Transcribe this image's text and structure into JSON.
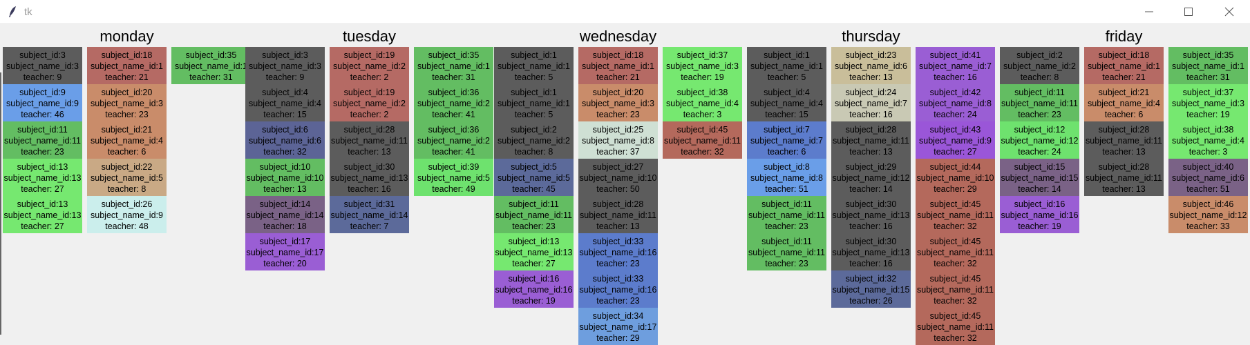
{
  "window": {
    "title": "tk",
    "app_icon": "tk-feather-icon",
    "controls": [
      "minimize-icon",
      "maximize-icon",
      "close-icon"
    ]
  },
  "labels": {
    "subject_id": "subject_id:",
    "subject_name_id": "subject_name_id:",
    "teacher": "teacher: "
  },
  "colors": {
    "dark": "#5c5c5c",
    "red": "#b56a64",
    "green": "#63bd62",
    "blue": "#6a9ee8",
    "orange": "#c98c6a",
    "lime": "#76e870",
    "tan": "#c9a985",
    "mint": "#cbeeec",
    "slate": "#5c6496",
    "plum": "#7a6286",
    "purple": "#9a5ed4",
    "slateblue": "#5c6a9a",
    "lightgreen": "#6ee26e",
    "sage": "#cfe0d4",
    "bluemid": "#5c7ccc",
    "khaki": "#c9be9a",
    "sand": "#c9c9b4",
    "violet": "#9a56d8",
    "redbrown": "#b4695c",
    "bluelight": "#6e9ede"
  },
  "days": [
    {
      "name": "monday",
      "columns": [
        [
          {
            "sid": "3",
            "sname": "3",
            "teacher": "9",
            "color": "dark"
          },
          {
            "sid": "9",
            "sname": "9",
            "teacher": "46",
            "color": "blue"
          },
          {
            "sid": "11",
            "sname": "11",
            "teacher": "23",
            "color": "green"
          },
          {
            "sid": "13",
            "sname": "13",
            "teacher": "27",
            "color": "lime"
          },
          {
            "sid": "13",
            "sname": "13",
            "teacher": "27",
            "color": "lime"
          }
        ],
        [
          {
            "sid": "18",
            "sname": "1",
            "teacher": "21",
            "color": "red"
          },
          {
            "sid": "20",
            "sname": "3",
            "teacher": "23",
            "color": "orange"
          },
          {
            "sid": "21",
            "sname": "4",
            "teacher": "6",
            "color": "orange"
          },
          {
            "sid": "22",
            "sname": "5",
            "teacher": "8",
            "color": "tan"
          },
          {
            "sid": "26",
            "sname": "9",
            "teacher": "48",
            "color": "mint"
          }
        ],
        [
          {
            "sid": "35",
            "sname": "1",
            "teacher": "31",
            "color": "green"
          }
        ]
      ]
    },
    {
      "name": "tuesday",
      "columns": [
        [
          {
            "sid": "3",
            "sname": "3",
            "teacher": "9",
            "color": "dark"
          },
          {
            "sid": "4",
            "sname": "4",
            "teacher": "15",
            "color": "dark"
          },
          {
            "sid": "6",
            "sname": "6",
            "teacher": "32",
            "color": "slate"
          },
          {
            "sid": "10",
            "sname": "10",
            "teacher": "13",
            "color": "green"
          },
          {
            "sid": "14",
            "sname": "14",
            "teacher": "18",
            "color": "plum"
          },
          {
            "sid": "17",
            "sname": "17",
            "teacher": "20",
            "color": "purple"
          }
        ],
        [
          {
            "sid": "19",
            "sname": "2",
            "teacher": "2",
            "color": "red"
          },
          {
            "sid": "19",
            "sname": "2",
            "teacher": "2",
            "color": "red"
          },
          {
            "sid": "28",
            "sname": "11",
            "teacher": "13",
            "color": "dark"
          },
          {
            "sid": "30",
            "sname": "13",
            "teacher": "16",
            "color": "dark"
          },
          {
            "sid": "31",
            "sname": "14",
            "teacher": "7",
            "color": "slateblue"
          }
        ],
        [
          {
            "sid": "35",
            "sname": "1",
            "teacher": "31",
            "color": "green"
          },
          {
            "sid": "36",
            "sname": "2",
            "teacher": "41",
            "color": "green"
          },
          {
            "sid": "36",
            "sname": "2",
            "teacher": "41",
            "color": "green"
          },
          {
            "sid": "39",
            "sname": "5",
            "teacher": "49",
            "color": "lightgreen"
          }
        ]
      ]
    },
    {
      "name": "wednesday",
      "columns": [
        [
          {
            "sid": "1",
            "sname": "1",
            "teacher": "5",
            "color": "dark"
          },
          {
            "sid": "1",
            "sname": "1",
            "teacher": "5",
            "color": "dark"
          },
          {
            "sid": "2",
            "sname": "2",
            "teacher": "8",
            "color": "dark"
          },
          {
            "sid": "5",
            "sname": "5",
            "teacher": "45",
            "color": "slateblue"
          },
          {
            "sid": "11",
            "sname": "11",
            "teacher": "23",
            "color": "green"
          },
          {
            "sid": "13",
            "sname": "13",
            "teacher": "27",
            "color": "lime"
          },
          {
            "sid": "16",
            "sname": "16",
            "teacher": "19",
            "color": "purple"
          }
        ],
        [
          {
            "sid": "18",
            "sname": "1",
            "teacher": "21",
            "color": "red"
          },
          {
            "sid": "20",
            "sname": "3",
            "teacher": "23",
            "color": "orange"
          },
          {
            "sid": "25",
            "sname": "8",
            "teacher": "37",
            "color": "sage"
          },
          {
            "sid": "27",
            "sname": "10",
            "teacher": "50",
            "color": "dark"
          },
          {
            "sid": "28",
            "sname": "11",
            "teacher": "13",
            "color": "dark"
          },
          {
            "sid": "33",
            "sname": "16",
            "teacher": "23",
            "color": "bluemid"
          },
          {
            "sid": "33",
            "sname": "16",
            "teacher": "23",
            "color": "bluemid"
          },
          {
            "sid": "34",
            "sname": "17",
            "teacher": "29",
            "color": "bluelight"
          }
        ],
        [
          {
            "sid": "37",
            "sname": "3",
            "teacher": "19",
            "color": "lime"
          },
          {
            "sid": "38",
            "sname": "4",
            "teacher": "3",
            "color": "lime"
          },
          {
            "sid": "45",
            "sname": "11",
            "teacher": "32",
            "color": "redbrown"
          }
        ]
      ]
    },
    {
      "name": "thursday",
      "columns": [
        [
          {
            "sid": "1",
            "sname": "1",
            "teacher": "5",
            "color": "dark"
          },
          {
            "sid": "4",
            "sname": "4",
            "teacher": "15",
            "color": "dark"
          },
          {
            "sid": "7",
            "sname": "7",
            "teacher": "6",
            "color": "bluemid"
          },
          {
            "sid": "8",
            "sname": "8",
            "teacher": "51",
            "color": "blue"
          },
          {
            "sid": "11",
            "sname": "11",
            "teacher": "23",
            "color": "green"
          },
          {
            "sid": "11",
            "sname": "11",
            "teacher": "23",
            "color": "green"
          }
        ],
        [
          {
            "sid": "23",
            "sname": "6",
            "teacher": "13",
            "color": "khaki"
          },
          {
            "sid": "24",
            "sname": "7",
            "teacher": "16",
            "color": "sand"
          },
          {
            "sid": "28",
            "sname": "11",
            "teacher": "13",
            "color": "dark"
          },
          {
            "sid": "29",
            "sname": "12",
            "teacher": "14",
            "color": "dark"
          },
          {
            "sid": "30",
            "sname": "13",
            "teacher": "16",
            "color": "dark"
          },
          {
            "sid": "30",
            "sname": "13",
            "teacher": "16",
            "color": "dark"
          },
          {
            "sid": "32",
            "sname": "15",
            "teacher": "26",
            "color": "slateblue"
          }
        ],
        [
          {
            "sid": "41",
            "sname": "7",
            "teacher": "16",
            "color": "purple"
          },
          {
            "sid": "42",
            "sname": "8",
            "teacher": "24",
            "color": "purple"
          },
          {
            "sid": "43",
            "sname": "9",
            "teacher": "27",
            "color": "violet"
          },
          {
            "sid": "44",
            "sname": "10",
            "teacher": "29",
            "color": "redbrown"
          },
          {
            "sid": "45",
            "sname": "11",
            "teacher": "32",
            "color": "redbrown"
          },
          {
            "sid": "45",
            "sname": "11",
            "teacher": "32",
            "color": "redbrown"
          },
          {
            "sid": "45",
            "sname": "11",
            "teacher": "32",
            "color": "redbrown"
          },
          {
            "sid": "45",
            "sname": "11",
            "teacher": "32",
            "color": "redbrown"
          }
        ]
      ]
    },
    {
      "name": "friday",
      "columns": [
        [
          {
            "sid": "2",
            "sname": "2",
            "teacher": "8",
            "color": "dark"
          },
          {
            "sid": "11",
            "sname": "11",
            "teacher": "23",
            "color": "green"
          },
          {
            "sid": "12",
            "sname": "12",
            "teacher": "24",
            "color": "lightgreen"
          },
          {
            "sid": "15",
            "sname": "15",
            "teacher": "14",
            "color": "plum"
          },
          {
            "sid": "16",
            "sname": "16",
            "teacher": "19",
            "color": "purple"
          }
        ],
        [
          {
            "sid": "18",
            "sname": "1",
            "teacher": "21",
            "color": "red"
          },
          {
            "sid": "21",
            "sname": "4",
            "teacher": "6",
            "color": "orange"
          },
          {
            "sid": "28",
            "sname": "11",
            "teacher": "13",
            "color": "dark"
          },
          {
            "sid": "28",
            "sname": "11",
            "teacher": "13",
            "color": "dark"
          }
        ],
        [
          {
            "sid": "35",
            "sname": "1",
            "teacher": "31",
            "color": "green"
          },
          {
            "sid": "37",
            "sname": "3",
            "teacher": "19",
            "color": "lime"
          },
          {
            "sid": "38",
            "sname": "4",
            "teacher": "3",
            "color": "lime"
          },
          {
            "sid": "40",
            "sname": "6",
            "teacher": "51",
            "color": "plum"
          },
          {
            "sid": "46",
            "sname": "12",
            "teacher": "33",
            "color": "orange"
          }
        ]
      ]
    }
  ]
}
